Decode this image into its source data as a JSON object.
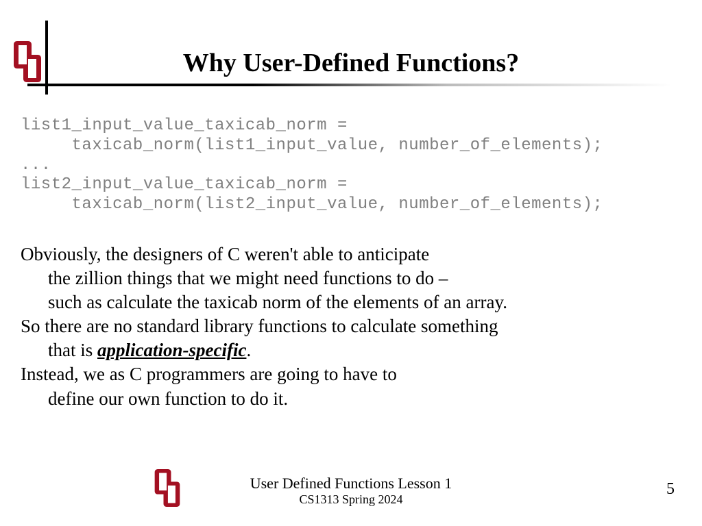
{
  "title": "Why User-Defined Functions?",
  "code": {
    "line1": "list1_input_value_taxicab_norm =",
    "line2": "     taxicab_norm(list1_input_value, number_of_elements);",
    "line3": "...",
    "line4": "list2_input_value_taxicab_norm =",
    "line5": "     taxicab_norm(list2_input_value, number_of_elements);"
  },
  "body": {
    "p1a": "Obviously, the designers of C weren't able to anticipate",
    "p1b": "the zillion things that we might need functions to do –",
    "p1c": "such as calculate the taxicab norm of the elements of an array.",
    "p2a": "So there are no standard library functions to calculate something",
    "p2b_pre": "that is ",
    "p2b_emph": "application-specific",
    "p2b_post": ".",
    "p3a": "Instead, we as C programmers are going to have to",
    "p3b": "define our own function to do it."
  },
  "footer": {
    "title": "User Defined Functions Lesson 1",
    "subtitle": "CS1313 Spring 2024"
  },
  "page_number": "5",
  "brand": {
    "color": "#a31022"
  }
}
